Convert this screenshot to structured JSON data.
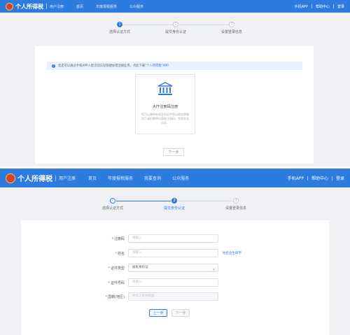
{
  "screen1": {
    "header": {
      "site_name": "个人所得税",
      "sub_name": "用户注册",
      "nav": [
        "首页",
        "年度报税服务",
        "公众服务"
      ],
      "right_links": [
        "手机APP",
        "帮助中心",
        "登录"
      ]
    },
    "steps": [
      {
        "num": "1",
        "label": "选择认证方式",
        "state": "active"
      },
      {
        "num": "2",
        "label": "提交身份认证",
        "state": "todo"
      },
      {
        "num": "3",
        "label": "设置登录信息",
        "state": "todo"
      }
    ],
    "notice": {
      "text": "您还可以通过手机APP人脸识别认证快捷办理注册业务，点此下载",
      "link": "\"个人所得税\"APP"
    },
    "card": {
      "title": "大厅注册码注册",
      "desc": "您可以携带有效身份证件到当地办税服务厅或扣缴单位获取注册码，完成实名认证。",
      "icon": "bank-building-icon"
    },
    "next_button": "下一步"
  },
  "screen2": {
    "header": {
      "site_name": "个人所得税",
      "sub_name": "用户注册",
      "nav": [
        "首页",
        "年度报税服务",
        "我要查询",
        "公众服务"
      ],
      "right_links": [
        "手机APP",
        "帮助中心",
        "登录"
      ]
    },
    "steps": [
      {
        "num": "✓",
        "label": "选择认证方式",
        "state": "done"
      },
      {
        "num": "2",
        "label": "提交身份认证",
        "state": "active"
      },
      {
        "num": "3",
        "label": "设置登录信息",
        "state": "todo"
      }
    ],
    "form": {
      "registration_code": {
        "label": "注册码",
        "placeholder": "请输入"
      },
      "name": {
        "label": "姓名",
        "placeholder": "请输入",
        "side_link": "姓名含生僻字"
      },
      "id_type": {
        "label": "证件类型",
        "value": "居民身份证"
      },
      "id_number": {
        "label": "证件号码",
        "placeholder": "请输入"
      },
      "nationality": {
        "label": "国籍(地区)",
        "placeholder": "中华人民共和国"
      }
    },
    "prev_button": "上一步",
    "next_button": "下一步"
  },
  "colors": {
    "primary": "#2e7be0",
    "background": "#f0f1f5",
    "required": "#e04b4b"
  }
}
